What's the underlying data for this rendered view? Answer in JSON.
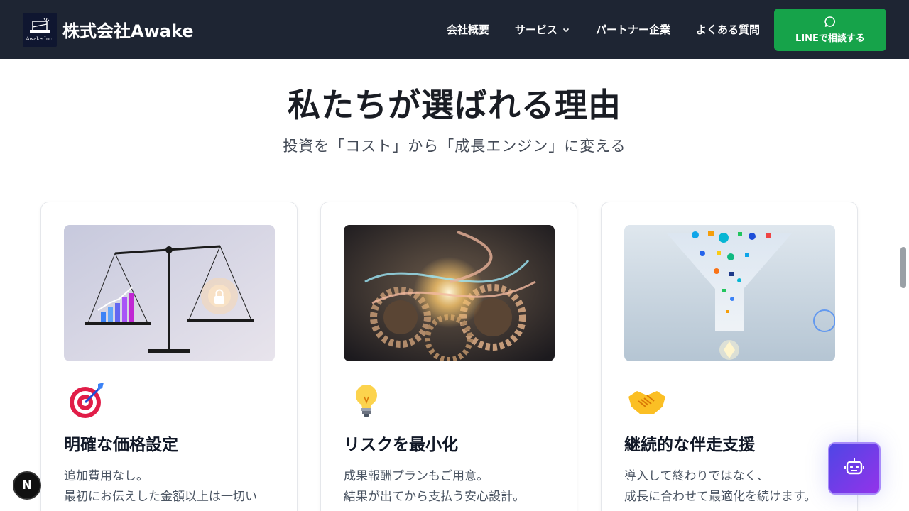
{
  "header": {
    "logo_text": "Awake Inc.",
    "brand": "株式会社Awake",
    "nav": [
      {
        "label": "会社概要"
      },
      {
        "label": "サービス"
      },
      {
        "label": "パートナー企業"
      },
      {
        "label": "よくある質問"
      }
    ],
    "cta_label": "LINEで相談する"
  },
  "section": {
    "title": "私たちが選ばれる理由",
    "subtitle": "投資を「コスト」から「成長エンジン」に変える"
  },
  "cards": [
    {
      "title": "明確な価格設定",
      "desc_1": "追加費用なし。",
      "desc_2": "最初にお伝えした金額以上は一切い",
      "icon": "target-icon"
    },
    {
      "title": "リスクを最小化",
      "desc_1": "成果報酬プランもご用意。",
      "desc_2": "結果が出てから支払う安心設計。",
      "icon": "lightbulb-icon"
    },
    {
      "title": "継続的な伴走支援",
      "desc_1": "導入して終わりではなく、",
      "desc_2": "成長に合わせて最適化を続けます。",
      "icon": "handshake-icon"
    }
  ],
  "floating": {
    "n_badge": "N",
    "bot_icon": "robot-icon"
  },
  "colors": {
    "header_bg": "#1e2533",
    "line_green": "#16a34a",
    "bot_gradient_start": "#4f46e5",
    "bot_gradient_end": "#9333ea"
  }
}
